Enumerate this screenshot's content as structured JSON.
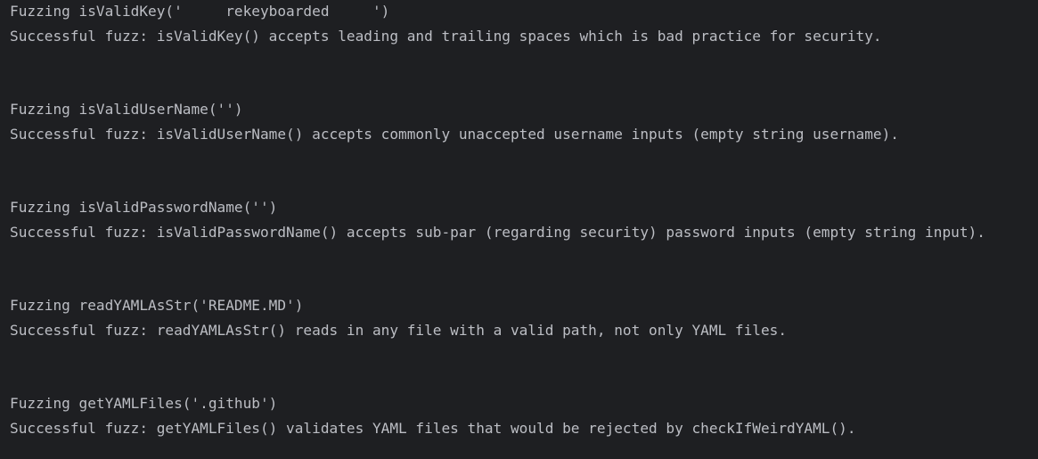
{
  "console": {
    "blocks": [
      {
        "input": "Fuzzing isValidKey('     rekeyboarded     ')",
        "result": "Successful fuzz: isValidKey() accepts leading and trailing spaces which is bad practice for security."
      },
      {
        "input": "Fuzzing isValidUserName('')",
        "result": "Successful fuzz: isValidUserName() accepts commonly unaccepted username inputs (empty string username)."
      },
      {
        "input": "Fuzzing isValidPasswordName('')",
        "result": "Successful fuzz: isValidPasswordName() accepts sub-par (regarding security) password inputs (empty string input)."
      },
      {
        "input": "Fuzzing readYAMLAsStr('README.MD')",
        "result": "Successful fuzz: readYAMLAsStr() reads in any file with a valid path, not only YAML files."
      },
      {
        "input": "Fuzzing getYAMLFiles('.github')",
        "result": "Successful fuzz: getYAMLFiles() validates YAML files that would be rejected by checkIfWeirdYAML()."
      }
    ]
  },
  "colors": {
    "background": "#1e1f22",
    "text": "#bcbec4"
  }
}
